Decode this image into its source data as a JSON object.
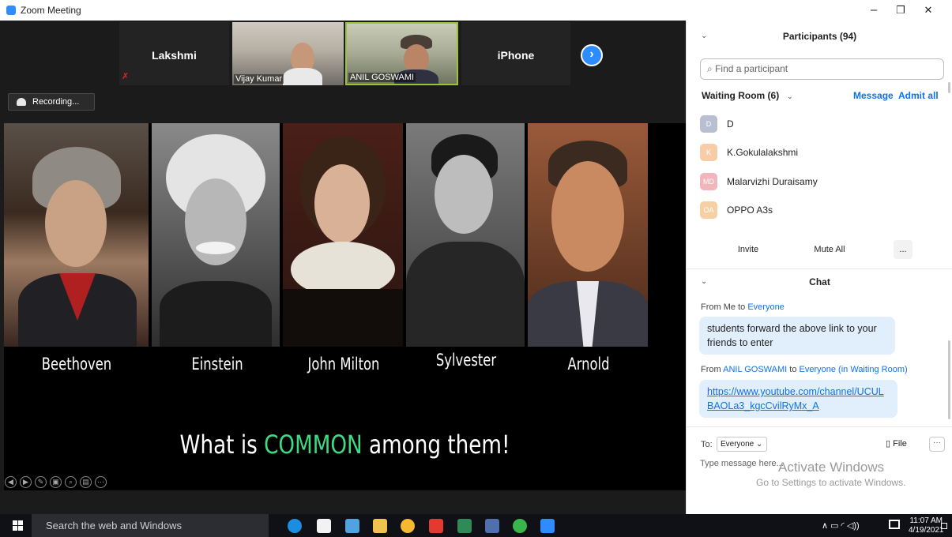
{
  "window": {
    "title": "Zoom Meeting",
    "controls": [
      "–",
      "❐",
      "✕"
    ]
  },
  "video_strip": {
    "tiles": [
      {
        "name": "Lakshmi",
        "type": "name"
      },
      {
        "name": "Vijay Kumar",
        "type": "video"
      },
      {
        "name": "ANIL GOSWAMI",
        "type": "video"
      },
      {
        "name": "iPhone",
        "type": "name"
      }
    ],
    "next_glyph": "›"
  },
  "recording": {
    "label": "Recording..."
  },
  "shared_screen": {
    "captions": [
      "Beethoven",
      "Einstein",
      "John Milton",
      "Sylvester",
      "Arnold"
    ],
    "question_pre": "What is ",
    "question_highlight": "COMMON",
    "question_post": " among them!",
    "highlight_color": "#3ddc84"
  },
  "participants": {
    "header": "Participants (94)",
    "search_placeholder": "Find a participant",
    "waiting_room_label": "Waiting Room (6)",
    "message_label": "Message",
    "admit_all_label": "Admit all",
    "waiting": [
      {
        "initials": "D",
        "name": "D",
        "color": "#b8bfd0"
      },
      {
        "initials": "K",
        "name": "K.Gokulalakshmi",
        "color": "#f6cda6"
      },
      {
        "initials": "MD",
        "name": "Malarvizhi Duraisamy",
        "color": "#f0b6bc"
      },
      {
        "initials": "OA",
        "name": "OPPO A3s",
        "color": "#f6cfa2"
      }
    ],
    "buttons": {
      "invite": "Invite",
      "mute_all": "Mute All",
      "more": "..."
    }
  },
  "chat": {
    "header": "Chat",
    "messages": [
      {
        "from": "Me",
        "to": "Everyone",
        "text": "students forward the above link to your friends to enter"
      },
      {
        "from": "ANIL GOSWAMI",
        "to": "Everyone (in Waiting Room)",
        "text": "https://www.youtube.com/channel/UCULBAOLa3_kgcCvilRyMx_A"
      }
    ],
    "from_prefix": "From",
    "to_word": "to",
    "compose": {
      "to_label": "To:",
      "recipient": "Everyone",
      "file_label": "File",
      "more_label": "···",
      "placeholder": "Type message here..."
    }
  },
  "watermark": {
    "line1": "Activate Windows",
    "line2": "Go to Settings to activate Windows."
  },
  "taskbar": {
    "search_placeholder": "Search the web and Windows",
    "time": "11:07 AM",
    "date": "4/19/2021",
    "tray_glyphs": "∧  ▭  ◜  ◁))"
  }
}
